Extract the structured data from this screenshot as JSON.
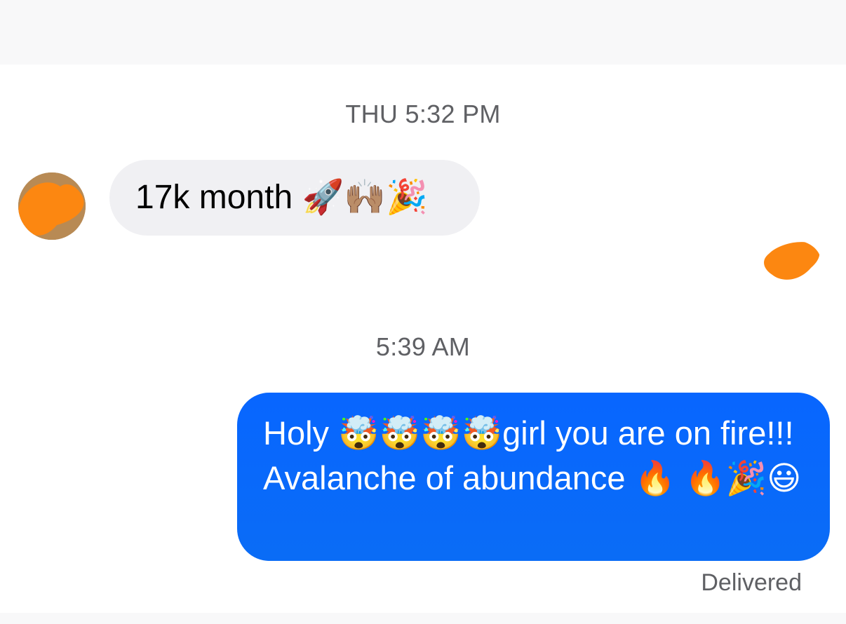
{
  "thread": {
    "timestamp_1": "THU 5:32 PM",
    "timestamp_2": "5:39 AM",
    "incoming": {
      "text": "17k month 🚀🙌🏽🎉"
    },
    "outgoing": {
      "text": "Holy 🤯🤯🤯🤯girl you are on fire!!! Avalanche of abundance 🔥 🔥🎉😃",
      "status": "Delivered"
    }
  },
  "colors": {
    "incoming_bubble": "#f0f0f3",
    "outgoing_bubble": "#0866ff",
    "redaction": "#fc8711",
    "timestamp_text": "#5f6064"
  }
}
